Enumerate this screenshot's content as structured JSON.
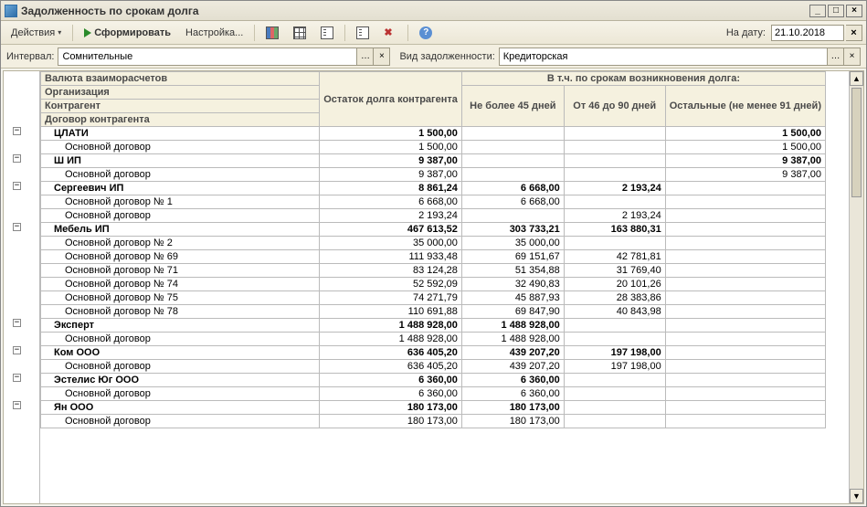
{
  "window": {
    "title": "Задолженность по срокам долга"
  },
  "toolbar": {
    "actions_label": "Действия",
    "form_label": "Сформировать",
    "settings_label": "Настройка...",
    "date_label": "На дату:",
    "date_value": "21.10.2018"
  },
  "filter": {
    "interval_label": "Интервал:",
    "interval_value": "Сомнительные",
    "type_label": "Вид задолженности:",
    "type_value": "Кредиторская"
  },
  "header": {
    "row_labels": [
      "Валюта взаиморасчетов",
      "Организация",
      "Контрагент",
      "Договор контрагента"
    ],
    "col_balance": "Остаток долга контрагента",
    "col_terms_header": "В т.ч. по срокам возникновения долга:",
    "col_terms": [
      "Не более 45 дней",
      "От 46 до 90 дней",
      "Остальные (не менее 91 дней)"
    ]
  },
  "rows": [
    {
      "group": true,
      "level": 0,
      "label": "ЦЛАТИ",
      "c1": "1 500,00",
      "c2": "",
      "c3": "",
      "c4": "1 500,00"
    },
    {
      "group": false,
      "level": 1,
      "label": "Основной договор",
      "c1": "1 500,00",
      "c2": "",
      "c3": "",
      "c4": "1 500,00"
    },
    {
      "group": true,
      "level": 0,
      "label": "Ш ИП",
      "c1": "9 387,00",
      "c2": "",
      "c3": "",
      "c4": "9 387,00"
    },
    {
      "group": false,
      "level": 1,
      "label": "Основной договор",
      "c1": "9 387,00",
      "c2": "",
      "c3": "",
      "c4": "9 387,00"
    },
    {
      "group": true,
      "level": 0,
      "label": "Сергеевич ИП",
      "c1": "8 861,24",
      "c2": "6 668,00",
      "c3": "2 193,24",
      "c4": ""
    },
    {
      "group": false,
      "level": 1,
      "label": "Основной договор № 1",
      "c1": "6 668,00",
      "c2": "6 668,00",
      "c3": "",
      "c4": ""
    },
    {
      "group": false,
      "level": 1,
      "label": "Основной договор",
      "c1": "2 193,24",
      "c2": "",
      "c3": "2 193,24",
      "c4": ""
    },
    {
      "group": true,
      "level": 0,
      "label": "Мебель ИП",
      "c1": "467 613,52",
      "c2": "303 733,21",
      "c3": "163 880,31",
      "c4": ""
    },
    {
      "group": false,
      "level": 1,
      "label": "Основной договор    № 2",
      "c1": "35 000,00",
      "c2": "35 000,00",
      "c3": "",
      "c4": ""
    },
    {
      "group": false,
      "level": 1,
      "label": "Основной договор    № 69",
      "c1": "111 933,48",
      "c2": "69 151,67",
      "c3": "42 781,81",
      "c4": ""
    },
    {
      "group": false,
      "level": 1,
      "label": "Основной договор    № 71",
      "c1": "83 124,28",
      "c2": "51 354,88",
      "c3": "31 769,40",
      "c4": ""
    },
    {
      "group": false,
      "level": 1,
      "label": "Основной договор    № 74",
      "c1": "52 592,09",
      "c2": "32 490,83",
      "c3": "20 101,26",
      "c4": ""
    },
    {
      "group": false,
      "level": 1,
      "label": "Основной договор    № 75",
      "c1": "74 271,79",
      "c2": "45 887,93",
      "c3": "28 383,86",
      "c4": ""
    },
    {
      "group": false,
      "level": 1,
      "label": "Основной договор    № 78",
      "c1": "110 691,88",
      "c2": "69 847,90",
      "c3": "40 843,98",
      "c4": ""
    },
    {
      "group": true,
      "level": 0,
      "label": "Эксперт",
      "c1": "1 488 928,00",
      "c2": "1 488 928,00",
      "c3": "",
      "c4": ""
    },
    {
      "group": false,
      "level": 1,
      "label": "Основной договор",
      "c1": "1 488 928,00",
      "c2": "1 488 928,00",
      "c3": "",
      "c4": ""
    },
    {
      "group": true,
      "level": 0,
      "label": "Ком ООО",
      "c1": "636 405,20",
      "c2": "439 207,20",
      "c3": "197 198,00",
      "c4": ""
    },
    {
      "group": false,
      "level": 1,
      "label": "Основной договор",
      "c1": "636 405,20",
      "c2": "439 207,20",
      "c3": "197 198,00",
      "c4": ""
    },
    {
      "group": true,
      "level": 0,
      "label": "Эстелис Юг ООО",
      "c1": "6 360,00",
      "c2": "6 360,00",
      "c3": "",
      "c4": ""
    },
    {
      "group": false,
      "level": 1,
      "label": "Основной договор",
      "c1": "6 360,00",
      "c2": "6 360,00",
      "c3": "",
      "c4": ""
    },
    {
      "group": true,
      "level": 0,
      "label": "Ян ООО",
      "c1": "180 173,00",
      "c2": "180 173,00",
      "c3": "",
      "c4": ""
    },
    {
      "group": false,
      "level": 1,
      "label": "Основной договор",
      "c1": "180 173,00",
      "c2": "180 173,00",
      "c3": "",
      "c4": ""
    }
  ]
}
